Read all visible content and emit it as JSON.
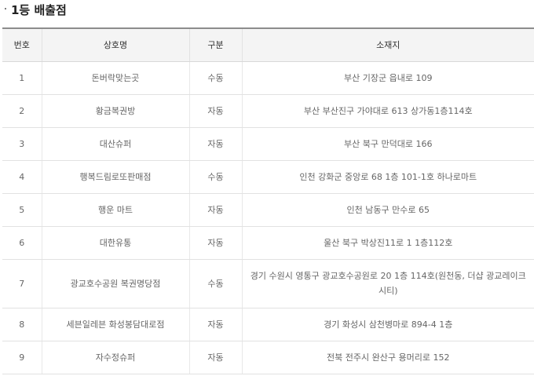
{
  "section": {
    "bullet": "·",
    "title": "1등 배출점"
  },
  "table": {
    "headers": {
      "no": "번호",
      "name": "상호명",
      "type": "구분",
      "address": "소재지"
    },
    "rows": [
      {
        "no": "1",
        "name": "돈버락맞는곳",
        "type": "수동",
        "address": "부산 기장군 읍내로 109"
      },
      {
        "no": "2",
        "name": "황금복권방",
        "type": "자동",
        "address": "부산 부산진구 가야대로 613 상가동1층114호"
      },
      {
        "no": "3",
        "name": "대산슈퍼",
        "type": "자동",
        "address": "부산 북구 만덕대로 166"
      },
      {
        "no": "4",
        "name": "행복드림로또판매점",
        "type": "수동",
        "address": "인천 강화군 중앙로 68 1층 101-1호 하나로마트"
      },
      {
        "no": "5",
        "name": "행운 마트",
        "type": "자동",
        "address": "인천 남동구 만수로 65"
      },
      {
        "no": "6",
        "name": "대한유통",
        "type": "자동",
        "address": "울산 북구 박상진11로 1 1층112호"
      },
      {
        "no": "7",
        "name": "광교호수공원 복권명당점",
        "type": "수동",
        "address": "경기 수원시 영통구 광교호수공원로 20 1층 114호(원천동, 더샵 광교레이크시티)"
      },
      {
        "no": "8",
        "name": "세븐일레븐 화성봉담대로점",
        "type": "자동",
        "address": "경기 화성시 삼천병마로 894-4 1층"
      },
      {
        "no": "9",
        "name": "자수정슈퍼",
        "type": "자동",
        "address": "전북 전주시 완산구 용머리로 152"
      }
    ]
  }
}
